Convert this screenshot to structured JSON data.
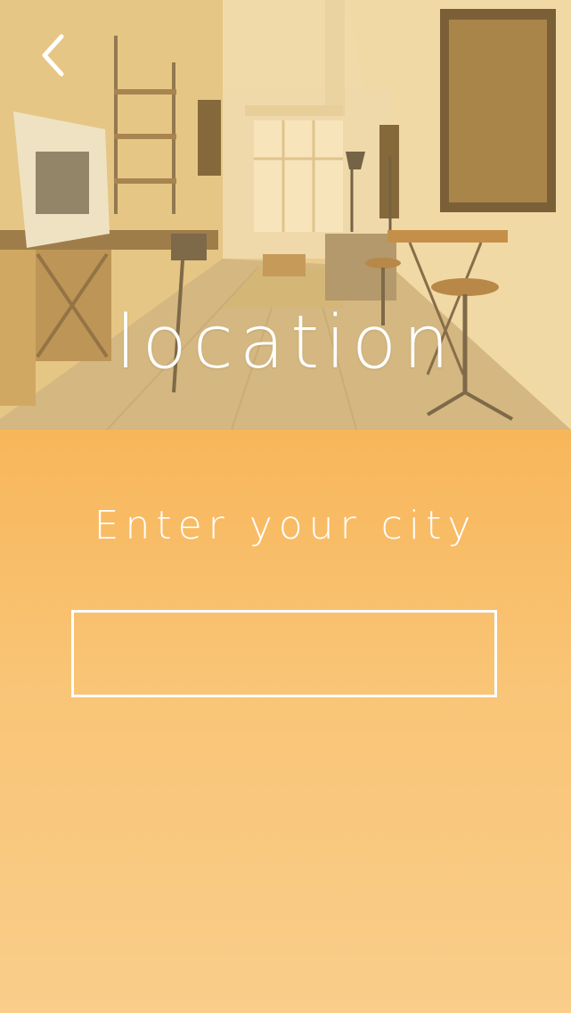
{
  "header": {
    "back_icon": "chevron-left-icon",
    "title": "location"
  },
  "form": {
    "prompt": "Enter your city",
    "city_input": {
      "value": "",
      "placeholder": ""
    }
  },
  "colors": {
    "accent_orange": "#f8b65a",
    "light_orange": "#f9cd8a",
    "text_white": "#ffffff"
  }
}
